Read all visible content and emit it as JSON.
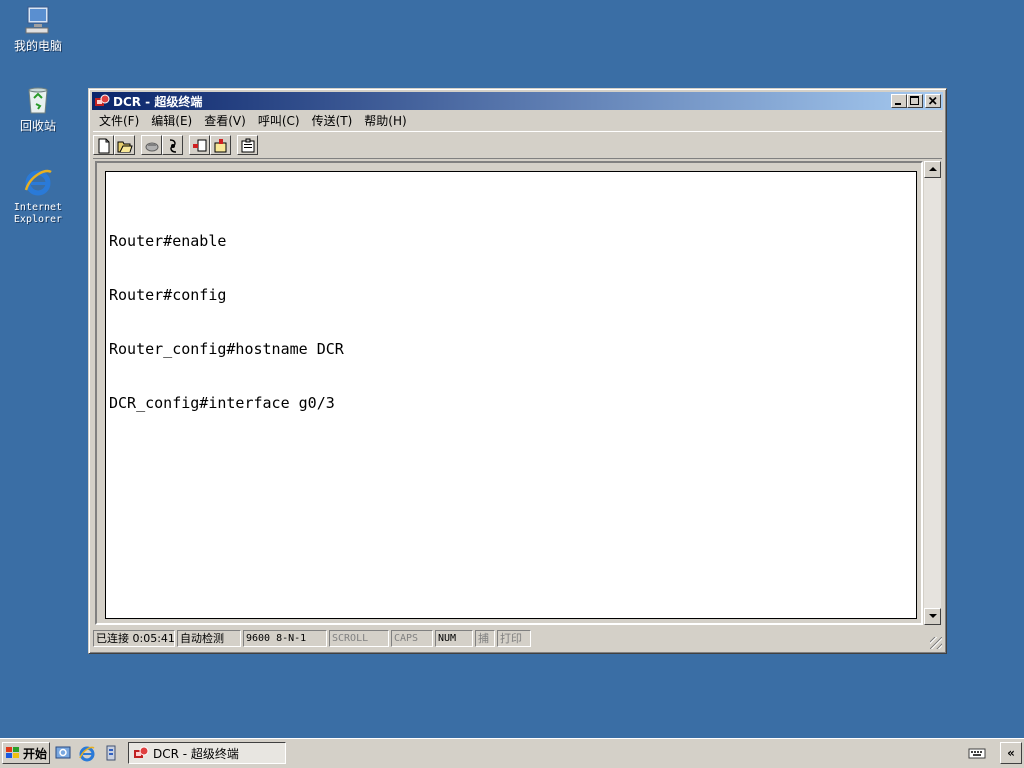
{
  "desktop": {
    "icons": [
      {
        "label": "我的电脑",
        "icon": "my-computer-icon"
      },
      {
        "label": "回收站",
        "icon": "recycle-bin-icon"
      },
      {
        "label": "Internet\nExplorer",
        "icon": "internet-explorer-icon"
      }
    ]
  },
  "window": {
    "title": "DCR - 超级终端",
    "menu": [
      {
        "label": "文件(F)"
      },
      {
        "label": "编辑(E)"
      },
      {
        "label": "查看(V)"
      },
      {
        "label": "呼叫(C)"
      },
      {
        "label": "传送(T)"
      },
      {
        "label": "帮助(H)"
      }
    ],
    "terminal_lines": [
      "Router#enable",
      "Router#config",
      "Router_config#hostname DCR",
      "DCR_config#interface g0/3"
    ],
    "status": {
      "connection": "已连接 0:05:41",
      "detect": "自动检测",
      "baud": "9600 8-N-1",
      "scroll": "SCROLL",
      "caps": "CAPS",
      "num": "NUM",
      "capture": "捕",
      "print": "打印"
    }
  },
  "taskbar": {
    "start_label": "开始",
    "task_label": "DCR - 超级终端",
    "chevron": "«"
  },
  "colors": {
    "desktop": "#3a6ea5",
    "title_start": "#0a246a",
    "title_end": "#a6caf0",
    "face": "#d4d0c8"
  }
}
